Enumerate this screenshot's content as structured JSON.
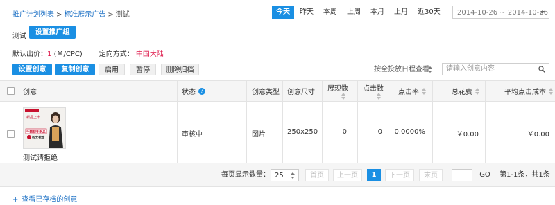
{
  "breadcrumb": {
    "item1": "推广计划列表",
    "sep": ">",
    "item2": "标准展示广告",
    "current": "测试"
  },
  "date_filters": [
    "今天",
    "昨天",
    "本周",
    "上周",
    "本月",
    "上月",
    "近30天"
  ],
  "date_range": "2014-10-26 ~ 2014-10-26",
  "group": {
    "label": "测试",
    "set_button": "设置推广组"
  },
  "bid": {
    "label": "默认出价：",
    "value": "1",
    "unit": "(￥/CPC)",
    "targeting_label": "定向方式：",
    "targeting_value": "中国大陆"
  },
  "actions": {
    "set_creative": "设置创意",
    "copy_creative": "复制创意",
    "enable": "启用",
    "pause": "暂停",
    "delete_archive": "删除归档"
  },
  "schedule_select": "按全投放日程查看",
  "search": {
    "placeholder": "请输入创意内容"
  },
  "table": {
    "headers": {
      "creative": "创意",
      "status": "状态",
      "type": "创意类型",
      "size": "创意尺寸",
      "impressions_line1": "展现数",
      "clicks_line1": "点击数",
      "ctr": "点击率",
      "cost": "总花费",
      "avg_cpc": "平均点击成本"
    },
    "rows": [
      {
        "caption": "测试请拒绝",
        "status": "审核中",
        "type": "图片",
        "size": "250x250",
        "impressions": "0",
        "clicks": "0",
        "ctr": "0.0000%",
        "cost": "￥0.00",
        "avg_cpc": "￥0.00",
        "thumb_text": [
          "新品上市",
          "千款初冬新品",
          "折大抢欢"
        ]
      }
    ]
  },
  "pager": {
    "page_size_label": "每页显示数量：",
    "page_size": "25",
    "first": "首页",
    "prev": "上一页",
    "current": "1",
    "next": "下一页",
    "last": "末页",
    "go": "GO",
    "summary": "第1-1条，共1条"
  },
  "archive_link": "查看已存档的创意",
  "colors": {
    "accent": "#1a8fe3",
    "link": "#1a6fc4",
    "warn": "#d14"
  }
}
